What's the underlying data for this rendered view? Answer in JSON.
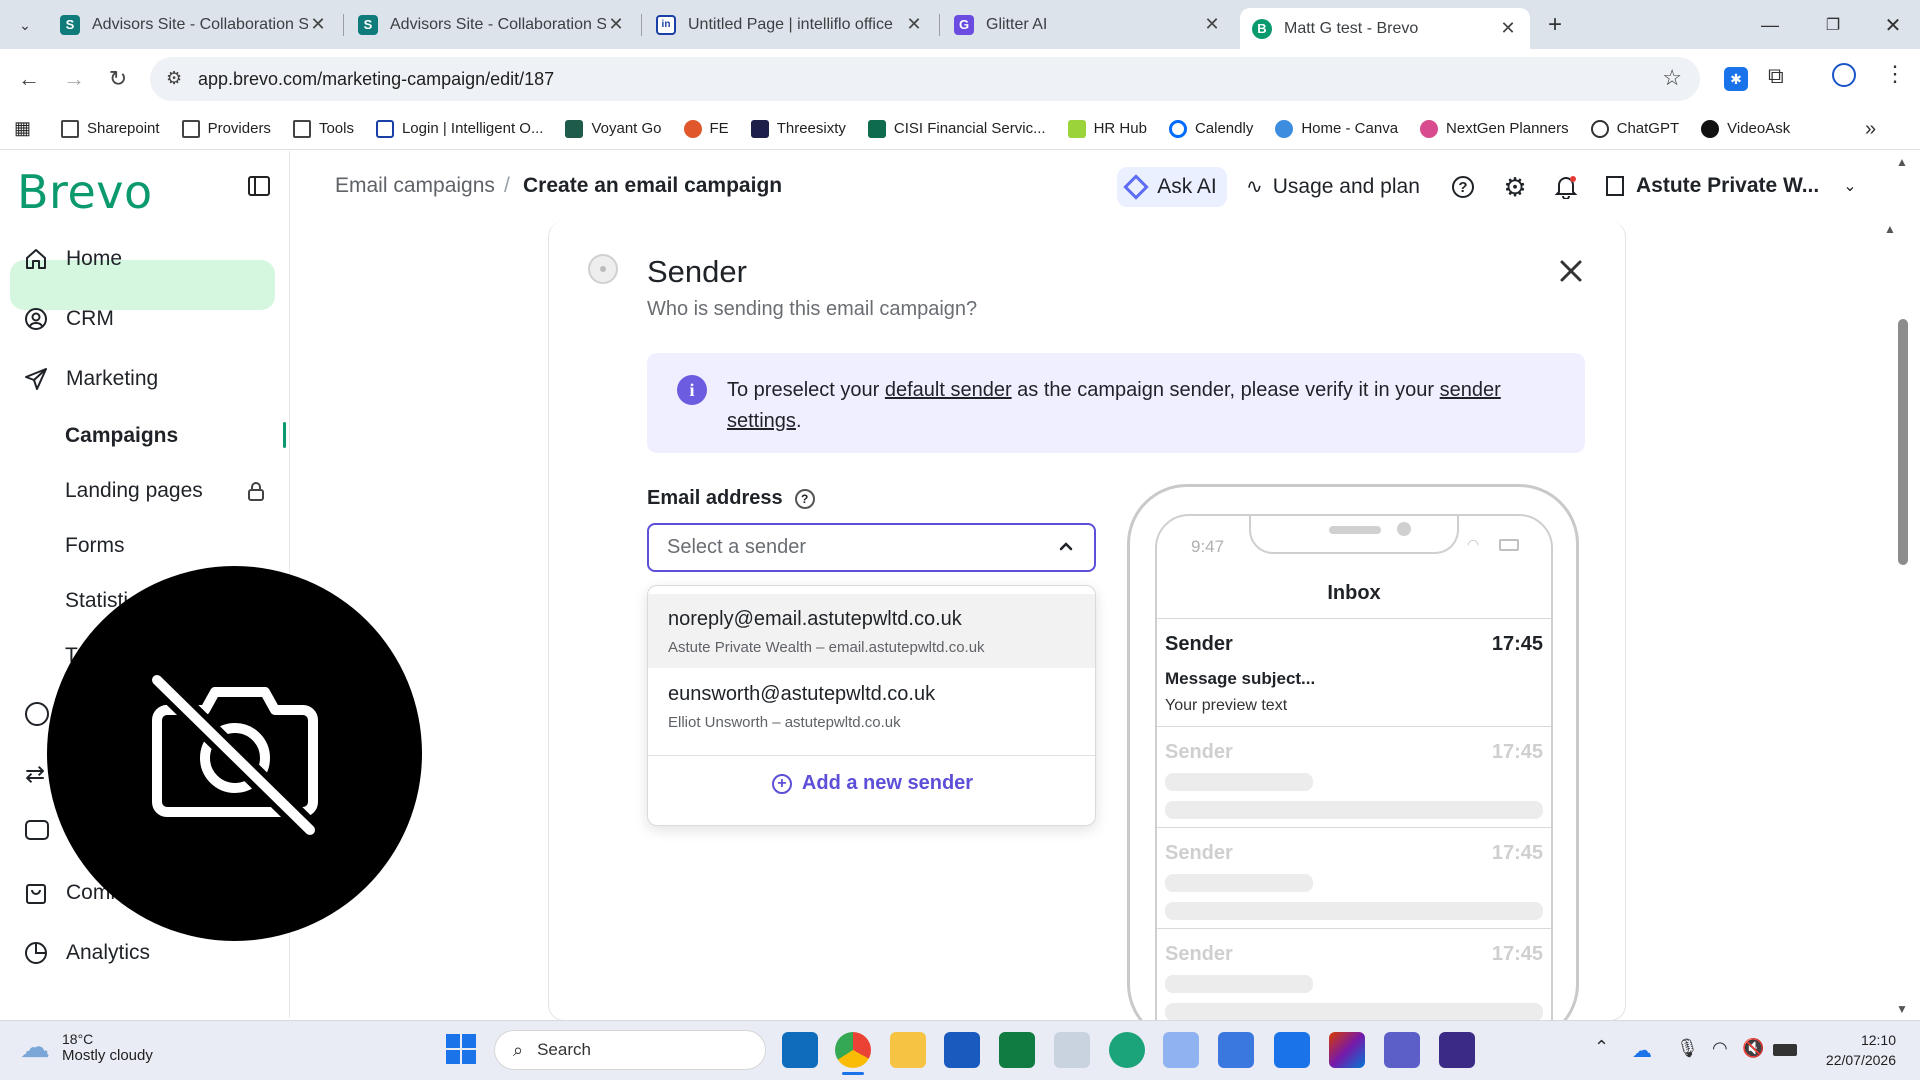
{
  "browser": {
    "tabs": [
      {
        "title": "Advisors Site - Collaboration Site",
        "icon": "sharepoint-icon"
      },
      {
        "title": "Advisors Site - Collaboration Site",
        "icon": "sharepoint-icon"
      },
      {
        "title": "Untitled Page | intelliflo office",
        "icon": "intelliflo-icon"
      },
      {
        "title": "Glitter AI",
        "icon": "glitter-icon"
      },
      {
        "title": "Matt G test - Brevo",
        "icon": "brevo-icon"
      }
    ],
    "url": "app.brevo.com/marketing-campaign/edit/187",
    "bookmarks": [
      "Sharepoint",
      "Providers",
      "Tools",
      "Login | Intelligent O...",
      "Voyant Go",
      "FE",
      "Threesixty",
      "CISI Financial Servic...",
      "HR Hub",
      "Calendly",
      "Home - Canva",
      "NextGen Planners",
      "ChatGPT",
      "VideoAsk"
    ]
  },
  "app": {
    "logo": "Brevo",
    "nav": {
      "home": "Home",
      "crm": "CRM",
      "marketing": "Marketing",
      "campaigns": "Campaigns",
      "landing_pages": "Landing pages",
      "forms": "Forms",
      "statistics": "Statisti",
      "t_item": "T",
      "commerce": "Comm",
      "analytics": "Analytics"
    },
    "breadcrumb": {
      "parent": "Email campaigns",
      "separator": "/",
      "current": "Create an email campaign"
    },
    "header": {
      "ask_ai": "Ask AI",
      "usage": "Usage and plan",
      "account": "Astute Private W..."
    }
  },
  "sender": {
    "title": "Sender",
    "subtitle": "Who is sending this email campaign?",
    "info_pre": "To preselect your ",
    "info_link1": "default sender",
    "info_mid": " as the campaign sender, please verify it in your ",
    "info_link2": "sender settings",
    "info_post": ".",
    "email_label": "Email address",
    "select_placeholder": "Select a sender",
    "options": [
      {
        "email": "noreply@email.astutepwltd.co.uk",
        "detail": "Astute Private Wealth – email.astutepwltd.co.uk"
      },
      {
        "email": "eunsworth@astutepwltd.co.uk",
        "detail": "Elliot Unsworth – astutepwltd.co.uk"
      }
    ],
    "add_sender": "Add a new sender"
  },
  "preview": {
    "time": "9:47",
    "inbox": "Inbox",
    "sender": "Sender",
    "msg_time": "17:45",
    "subject": "Message subject...",
    "preview_text": "Your preview text"
  },
  "taskbar": {
    "weather_temp": "18°C",
    "weather_desc": "Mostly cloudy",
    "search": "Search",
    "clock_time": "12:10",
    "clock_date": "22/07/2026"
  },
  "colors": {
    "brand_green": "#0b996e",
    "accent_purple": "#5d4fd8",
    "info_bg": "#f0efff",
    "active_nav": "#d5f7e0"
  }
}
